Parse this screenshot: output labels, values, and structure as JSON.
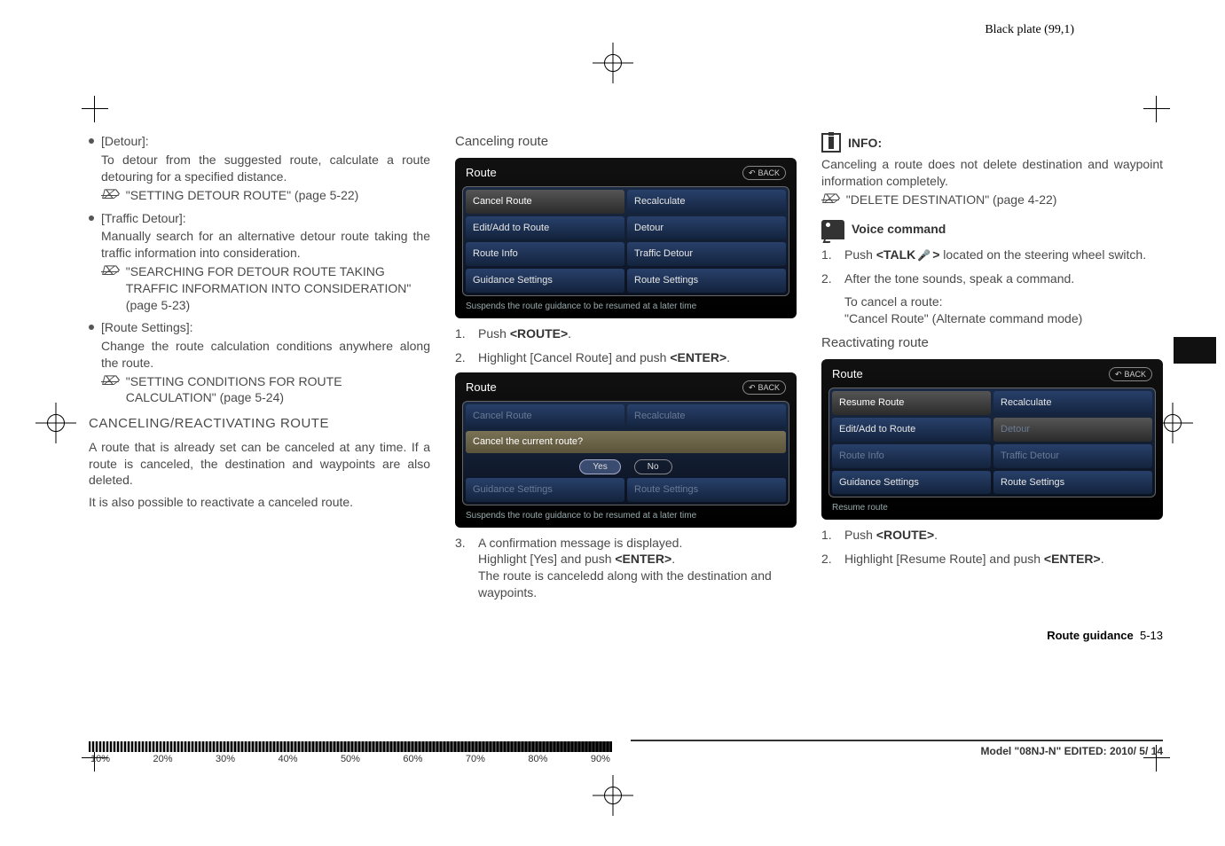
{
  "meta": {
    "black_plate": "Black plate (99,1)"
  },
  "col1": {
    "items": [
      {
        "title": "[Detour]:",
        "body": "To detour from the suggested route, calculate a route detouring for a specified distance.",
        "ref": "\"SETTING DETOUR ROUTE\" (page 5-22)"
      },
      {
        "title": "[Traffic Detour]:",
        "body": "Manually search for an alternative detour route taking the traffic information into consideration.",
        "ref": "\"SEARCHING FOR DETOUR ROUTE TAKING TRAFFIC INFORMATION INTO CONSIDERATION\" (page 5-23)"
      },
      {
        "title": "[Route Settings]:",
        "body": "Change the route calculation conditions anywhere along the route.",
        "ref": "\"SETTING CONDITIONS FOR ROUTE CALCULATION\" (page 5-24)"
      }
    ],
    "heading": "CANCELING/REACTIVATING ROUTE",
    "para1": "A route that is already set can be canceled at any time. If a route is canceled, the destination and waypoints are also deleted.",
    "para2": "It is also possible to reactivate a canceled route."
  },
  "col2": {
    "heading": "Canceling route",
    "shot1": {
      "title": "Route",
      "back": "BACK",
      "cells": [
        [
          "Cancel Route",
          true
        ],
        [
          "Recalculate",
          false
        ],
        [
          "Edit/Add to Route",
          false
        ],
        [
          "Detour",
          false
        ],
        [
          "Route Info",
          false
        ],
        [
          "Traffic Detour",
          false
        ],
        [
          "Guidance Settings",
          false
        ],
        [
          "Route Settings",
          false
        ]
      ],
      "footer": "Suspends the route guidance to be resumed at a later time"
    },
    "step1": "Push <ROUTE>.",
    "step2": "Highlight [Cancel Route] and push <ENTER>.",
    "shot2": {
      "title": "Route",
      "back": "BACK",
      "dimcells": [
        [
          "Cancel Route",
          "Recalculate"
        ]
      ],
      "confirm": "Cancel the current route?",
      "yes": "Yes",
      "no": "No",
      "bottomcells": [
        [
          "Guidance Settings",
          "Route Settings"
        ]
      ],
      "footer": "Suspends the route guidance to be resumed at a later time"
    },
    "step3a": "A confirmation message is displayed.",
    "step3b": "Highlight [Yes] and push <ENTER>.",
    "step3c": "The route is canceledd along with the destination and waypoints."
  },
  "col3": {
    "info_label": "INFO:",
    "info_body": "Canceling a route does not delete destination and waypoint information completely.",
    "info_ref": "\"DELETE DESTINATION\" (page 4-22)",
    "voice_label": "Voice command",
    "vstep1a": "Push ",
    "vstep1b": "<TALK",
    "vstep1c": " > ",
    "vstep1d": "located on the steering wheel switch.",
    "vstep2": "After the tone sounds, speak a command.",
    "vnote1": "To cancel a route:",
    "vnote2": "\"Cancel Route\" (Alternate command mode)",
    "react_heading": "Reactivating route",
    "shot3": {
      "title": "Route",
      "back": "BACK",
      "cells": [
        [
          "Resume Route",
          true
        ],
        [
          "Recalculate",
          false
        ],
        [
          "Edit/Add to Route",
          false
        ],
        [
          "Detour",
          true,
          "dim"
        ],
        [
          "Route Info",
          false,
          "dim"
        ],
        [
          "Traffic Detour",
          false,
          "dim"
        ],
        [
          "Guidance Settings",
          false
        ],
        [
          "Route Settings",
          false
        ]
      ],
      "footer": "Resume route"
    },
    "rstep1": "Push <ROUTE>.",
    "rstep2": "Highlight [Resume Route] and push <ENTER>."
  },
  "footer": {
    "guide": "Route guidance",
    "page": "5-13",
    "model": "Model \"08NJ-N\"  EDITED:  2010/ 5/ 14",
    "ruler": [
      "10%",
      "20%",
      "30%",
      "40%",
      "50%",
      "60%",
      "70%",
      "80%",
      "90%"
    ]
  },
  "chart_data": null
}
